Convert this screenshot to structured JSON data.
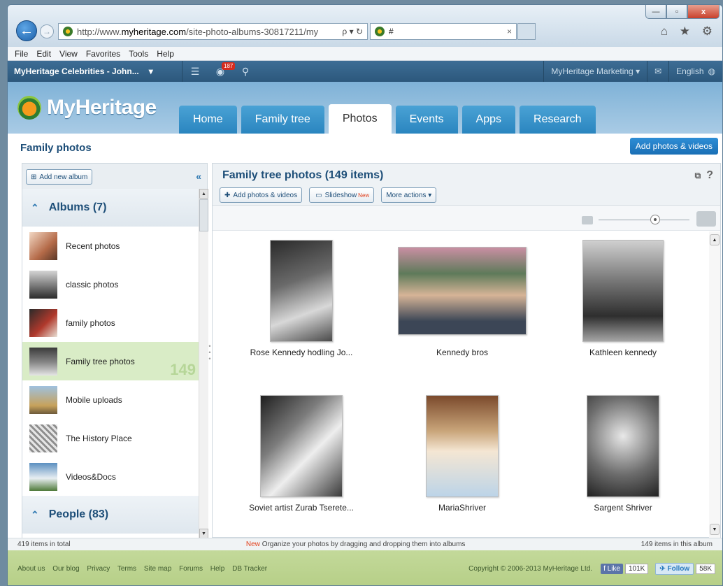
{
  "browser": {
    "url_prefix": "http://www.",
    "url_domain": "myheritage.com",
    "url_path": "/site-photo-albums-30817211/my",
    "url_controls": "ρ ▾ ↻",
    "tab_title": "#",
    "tab_close": "×",
    "back_glyph": "←",
    "forward_glyph": "→",
    "tools": "⌂ ★ ⚙",
    "window_buttons": {
      "minimize": "—",
      "maximize": "▫",
      "close": "x"
    }
  },
  "menu": [
    "File",
    "Edit",
    "View",
    "Favorites",
    "Tools",
    "Help"
  ],
  "topbar": {
    "site_name": "MyHeritage Celebrities - John...",
    "site_caret": "▾",
    "badge": "187",
    "account": "MyHeritage Marketing ▾",
    "mail_glyph": "✉",
    "language": "English"
  },
  "logo": "MyHeritage",
  "nav_tabs": [
    "Home",
    "Family tree",
    "Photos",
    "Events",
    "Apps",
    "Research"
  ],
  "page": {
    "title": "Family photos",
    "add_button": "Add photos & videos"
  },
  "sidebar": {
    "add_album": "Add new album",
    "collapse": "«",
    "albums_header": "Albums (7)",
    "people_header": "People (83)",
    "albums": [
      {
        "label": "Recent photos",
        "color": "#b46a48"
      },
      {
        "label": "classic photos",
        "color": "#6f6f6f"
      },
      {
        "label": "family photos",
        "color": "#b0392c"
      },
      {
        "label": "Family tree photos",
        "color": "#8a8a8a",
        "count": "149"
      },
      {
        "label": "Mobile uploads",
        "color": "#c7a25b"
      },
      {
        "label": "The History Place",
        "color": "#8d8d8d"
      },
      {
        "label": "Videos&Docs",
        "color": "#5b8fc0"
      }
    ]
  },
  "main": {
    "title": "Family tree photos (149 items)",
    "btn_add": "Add photos & videos",
    "btn_slideshow": "Slideshow",
    "btn_new": "New",
    "btn_more": "More actions ▾",
    "help": "?",
    "photos": [
      {
        "caption": "Rose Kennedy hodling Jo...",
        "color": "#6a6a6a"
      },
      {
        "caption": "Kennedy bros",
        "color": "#5e7a5a"
      },
      {
        "caption": "Kathleen kennedy",
        "color": "#777777"
      },
      {
        "caption": "Soviet artist Zurab Tserete...",
        "color": "#7c7c7c"
      },
      {
        "caption": "MariaShriver",
        "color": "#c9a57a"
      },
      {
        "caption": "Sargent Shriver",
        "color": "#6d6d6d"
      }
    ]
  },
  "status": {
    "left": "419 items in total",
    "new": "New",
    "mid": "Organize your photos by dragging and dropping them into albums",
    "right": "149 items in this album"
  },
  "footer": {
    "links": [
      "About us",
      "Our blog",
      "Privacy",
      "Terms",
      "Site map",
      "Forums",
      "Help",
      "DB Tracker"
    ],
    "copyright": "Copyright © 2006-2013 MyHeritage Ltd.",
    "like": "Like",
    "like_count": "101K",
    "follow": "Follow",
    "follow_count": "58K"
  }
}
